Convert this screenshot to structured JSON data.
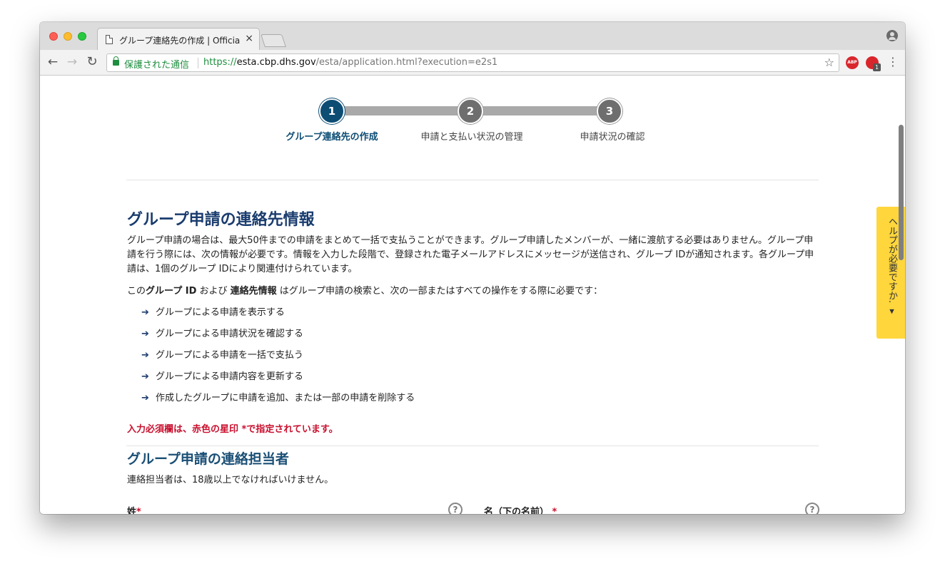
{
  "browser": {
    "tab_title": "グループ連絡先の作成 | Official",
    "tab_close": "×",
    "secure_label": "保護された通信",
    "url_scheme": "https://",
    "url_host": "esta.cbp.dhs.gov",
    "url_path": "/esta/application.html?execution=e2s1",
    "abp_label": "ABP",
    "ext_badge": "1",
    "back_glyph": "←",
    "forward_glyph": "→",
    "reload_glyph": "↻",
    "star_glyph": "☆",
    "menu_glyph": "⋮"
  },
  "steps": [
    {
      "number": "1",
      "label": "グループ連絡先の作成",
      "active": true
    },
    {
      "number": "2",
      "label": "申請と支払い状況の管理",
      "active": false
    },
    {
      "number": "3",
      "label": "申請状況の確認",
      "active": false
    }
  ],
  "help_tab": "ヘルプが必要ですか. ▾",
  "main": {
    "heading": "グループ申請の連絡先情報",
    "para1": "グループ申請の場合は、最大50件までの申請をまとめて一括で支払うことができます。グループ申請したメンバーが、一緒に渡航する必要はありません。グループ申請を行う際には、次の情報が必要です。情報を入力した段階で、登録された電子メールアドレスにメッセージが送信され、グループ IDが通知されます。各グループ申請は、1個のグループ IDにより関連付けられています。",
    "para2_prefix": "この",
    "para2_bold1": "グループ ID",
    "para2_mid": " および ",
    "para2_bold2": "連絡先情報",
    "para2_suffix": " はグループ申請の検索と、次の一部またはすべての操作をする際に必要です：",
    "list_arrow": "➔",
    "list": [
      "グループによる申請を表示する",
      "グループによる申請状況を確認する",
      "グループによる申請を一括で支払う",
      "グループによる申請内容を更新する",
      "作成したグループに申請を追加、または一部の申請を削除する"
    ],
    "required_note": "入力必須欄は、赤色の星印 *で指定されています。",
    "subheading": "グループ申請の連絡担当者",
    "age_note": "連絡担当者は、18歳以上でなければいけません。",
    "field_last_name": "姓",
    "field_first_name": "名（下の名前）",
    "required_mark": "*",
    "help_glyph": "?"
  }
}
